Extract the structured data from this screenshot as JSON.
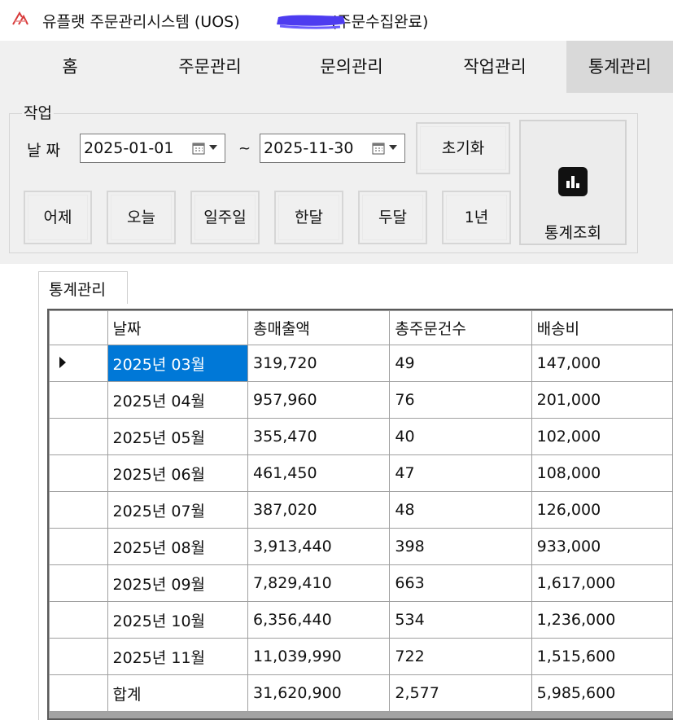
{
  "window": {
    "title": "유플랫 주문관리시스템 (UOS)",
    "title_suffix": "(주문수집완료)"
  },
  "menu": [
    {
      "label": "홈"
    },
    {
      "label": "주문관리"
    },
    {
      "label": "문의관리"
    },
    {
      "label": "작업관리"
    },
    {
      "label": "통계관리"
    }
  ],
  "work": {
    "group_label": "작업",
    "date_label": "날 짜",
    "date_from": "2025-01-01",
    "date_to": "2025-11-30",
    "range_separator": "~",
    "reset_label": "초기화",
    "quick_buttons": [
      "어제",
      "오늘",
      "일주일",
      "한달",
      "두달",
      "1년"
    ],
    "stat_query_label": "통계조회"
  },
  "stats": {
    "tab_label": "통계관리",
    "columns": [
      "날짜",
      "총매출액",
      "총주문건수",
      "배송비"
    ],
    "rows": [
      [
        "2025년 03월",
        "319,720",
        "49",
        "147,000"
      ],
      [
        "2025년 04월",
        "957,960",
        "76",
        "201,000"
      ],
      [
        "2025년 05월",
        "355,470",
        "40",
        "102,000"
      ],
      [
        "2025년 06월",
        "461,450",
        "47",
        "108,000"
      ],
      [
        "2025년 07월",
        "387,020",
        "48",
        "126,000"
      ],
      [
        "2025년 08월",
        "3,913,440",
        "398",
        "933,000"
      ],
      [
        "2025년 09월",
        "7,829,410",
        "663",
        "1,617,000"
      ],
      [
        "2025년 10월",
        "6,356,440",
        "534",
        "1,236,000"
      ],
      [
        "2025년 11월",
        "11,039,990",
        "722",
        "1,515,600"
      ],
      [
        "합계",
        "31,620,900",
        "2,577",
        "5,985,600"
      ]
    ]
  },
  "colors": {
    "selection": "#0078d7",
    "active_menu": "#d9d9d9",
    "logo_red": "#d83b3b"
  }
}
